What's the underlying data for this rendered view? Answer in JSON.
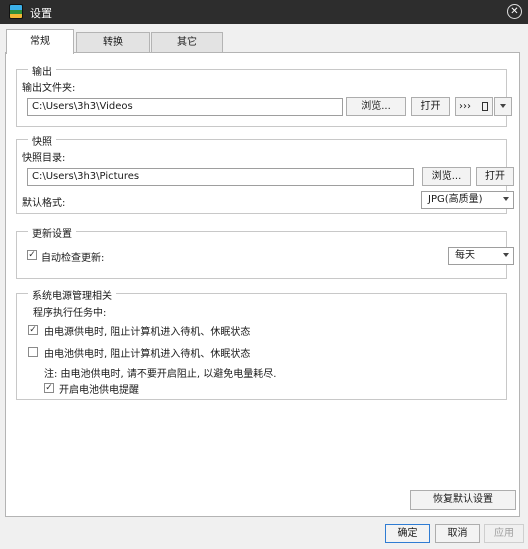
{
  "window": {
    "title": "设置",
    "close_glyph": "✕",
    "app_icon": "settings-app-icon"
  },
  "tabs": [
    {
      "label": "常规",
      "active": true
    },
    {
      "label": "转换",
      "active": false
    },
    {
      "label": "其它",
      "active": false
    }
  ],
  "output": {
    "legend": "输出",
    "folder_label": "输出文件夹:",
    "folder_value": "C:\\Users\\3h3\\Videos",
    "browse_label": "浏览...",
    "open_label": "打开",
    "extra_button_text": "›››",
    "extra_button_icon": "device-icon",
    "dropdown_icon": "chevron-down-icon"
  },
  "snapshot": {
    "legend": "快照",
    "dir_label": "快照目录:",
    "dir_value": "C:\\Users\\3h3\\Pictures",
    "browse_label": "浏览...",
    "open_label": "打开",
    "format_label": "默认格式:",
    "format_value": "JPG(高质量)"
  },
  "update": {
    "legend": "更新设置",
    "auto_check_label": "自动检查更新:",
    "auto_check_checked": true,
    "frequency_value": "每天"
  },
  "power": {
    "legend": "系统电源管理相关",
    "subtitle": "程序执行任务中:",
    "ac_label": "由电源供电时, 阻止计算机进入待机、休眠状态",
    "ac_checked": true,
    "battery_label": "由电池供电时, 阻止计算机进入待机、休眠状态",
    "battery_checked": false,
    "note": "注: 由电池供电时, 请不要开启阻止, 以避免电量耗尽.",
    "battery_reminder_label": "开启电池供电提醒",
    "battery_reminder_checked": true
  },
  "restore_defaults_label": "恢复默认设置",
  "footer": {
    "ok_label": "确定",
    "cancel_label": "取消",
    "apply_label": "应用"
  },
  "check_glyph": "✓"
}
